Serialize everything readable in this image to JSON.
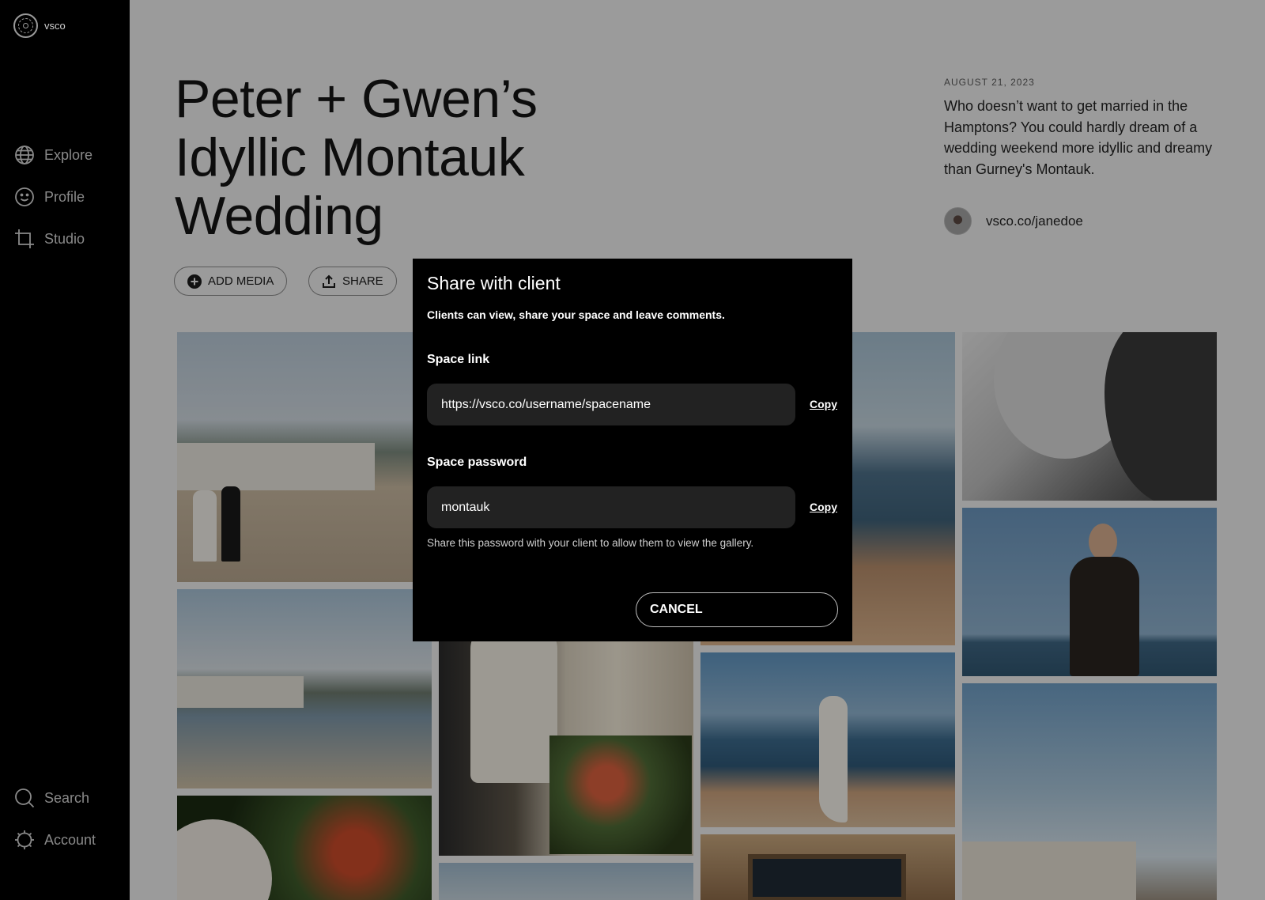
{
  "brand": {
    "name": "vsco"
  },
  "nav": {
    "explore": "Explore",
    "profile": "Profile",
    "studio": "Studio",
    "search": "Search",
    "account": "Account"
  },
  "space": {
    "title": "Peter + Gwen’s Idyllic Montauk Wedding",
    "date": "AUGUST 21, 2023",
    "description": "Who doesn’t want to get married in the Hamptons? You could hardly dream of a wedding weekend more idyllic and dreamy than Gurney's Montauk.",
    "author": "vsco.co/janedoe"
  },
  "actions": {
    "add_media": "ADD MEDIA",
    "share": "SHARE"
  },
  "modal": {
    "title": "Share with client",
    "subtitle": "Clients can view, share your space and leave comments.",
    "link_label": "Space link",
    "link_value": "https://vsco.co/username/spacename",
    "password_label": "Space password",
    "password_value": "montauk",
    "copy_label": "Copy",
    "hint": "Share this password with your client to allow them to view the gallery.",
    "cancel": "CANCEL"
  }
}
